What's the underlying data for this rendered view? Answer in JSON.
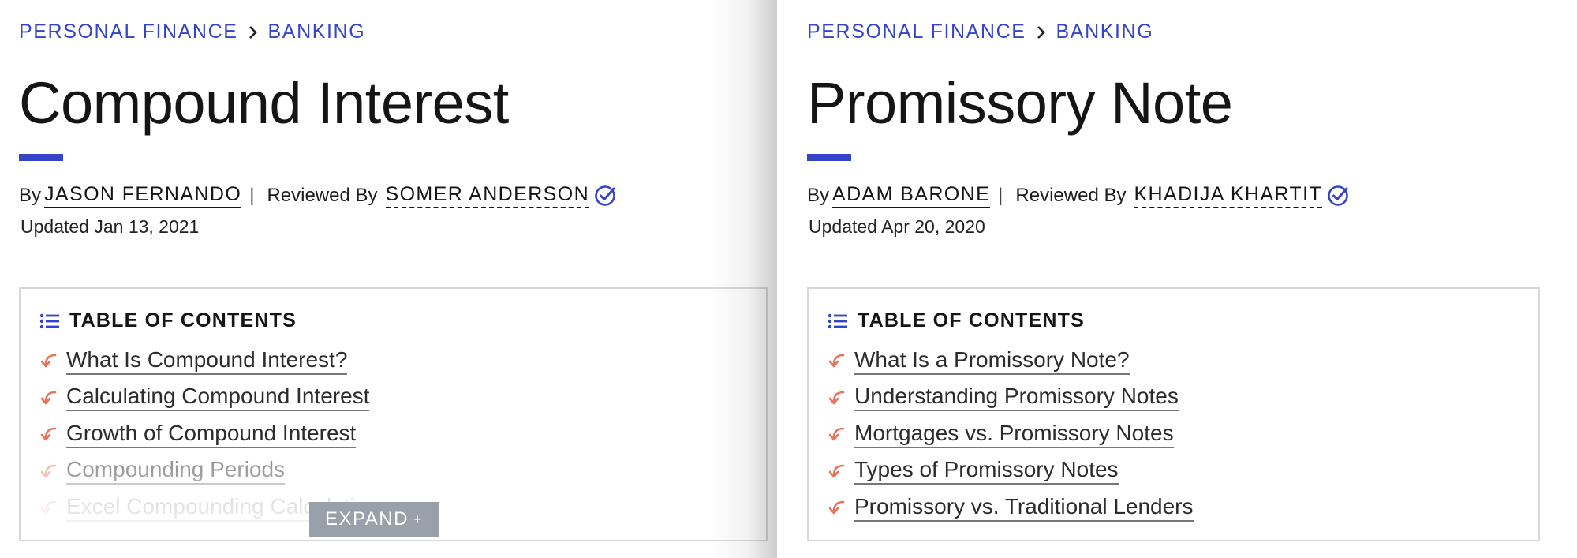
{
  "articles": [
    {
      "breadcrumb": [
        "PERSONAL FINANCE",
        "BANKING"
      ],
      "title": "Compound Interest",
      "by_label": "By",
      "author": "JASON FERNANDO",
      "separator": "|",
      "reviewed_label": "Reviewed By",
      "reviewer": "SOMER ANDERSON",
      "updated": "Updated Jan 13, 2021",
      "toc_title": "TABLE OF CONTENTS",
      "toc": [
        "What Is Compound Interest?",
        "Calculating Compound Interest",
        "Growth of Compound Interest",
        "Compounding Periods",
        "Excel Compounding Calculation"
      ],
      "expand_label": "EXPAND",
      "expand_icon": "+"
    },
    {
      "breadcrumb": [
        "PERSONAL FINANCE",
        "BANKING"
      ],
      "title": "Promissory Note",
      "by_label": "By",
      "author": "ADAM BARONE",
      "separator": "|",
      "reviewed_label": "Reviewed By",
      "reviewer": "KHADIJA KHARTIT",
      "updated": "Updated Apr 20, 2020",
      "toc_title": "TABLE OF CONTENTS",
      "toc": [
        "What Is a Promissory Note?",
        "Understanding Promissory Notes",
        "Mortgages vs. Promissory Notes",
        "Types of Promissory Notes",
        "Promissory vs. Traditional Lenders"
      ]
    }
  ],
  "colors": {
    "accent": "#3545c9",
    "toc_arrow": "#e8735a",
    "verified_check": "#3545c9",
    "expand_bg": "#9aa0aa"
  },
  "icons": {
    "breadcrumb_separator": "chevron-right-icon",
    "verified": "verified-check-icon",
    "toc_header": "list-icon",
    "toc_item": "curved-arrow-icon"
  }
}
